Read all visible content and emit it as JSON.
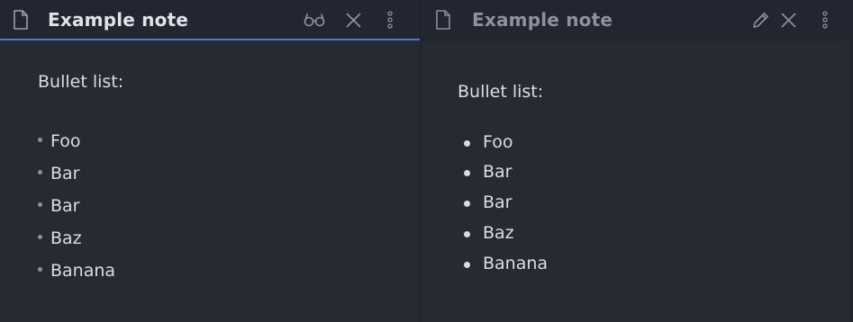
{
  "left_pane": {
    "title": "Example note",
    "mode": "source",
    "icons": [
      "file-icon",
      "reading-view-icon",
      "close-icon",
      "more-options-icon"
    ],
    "lines": {
      "heading": "Bullet list:",
      "items": [
        "Foo",
        "Bar",
        "Bar",
        "Baz",
        "Banana"
      ]
    }
  },
  "right_pane": {
    "title": "Example note",
    "mode": "preview",
    "icons": [
      "file-icon",
      "edit-icon",
      "close-icon",
      "more-options-icon"
    ],
    "lines": {
      "heading": "Bullet list:",
      "items": [
        "Foo",
        "Bar",
        "Bar",
        "Baz",
        "Banana"
      ]
    }
  },
  "colors": {
    "background": "#262a33",
    "header_background": "#222630",
    "active_tab_accent": "#4a7fd0",
    "text": "#dadde3",
    "muted_text": "#8d939d"
  }
}
